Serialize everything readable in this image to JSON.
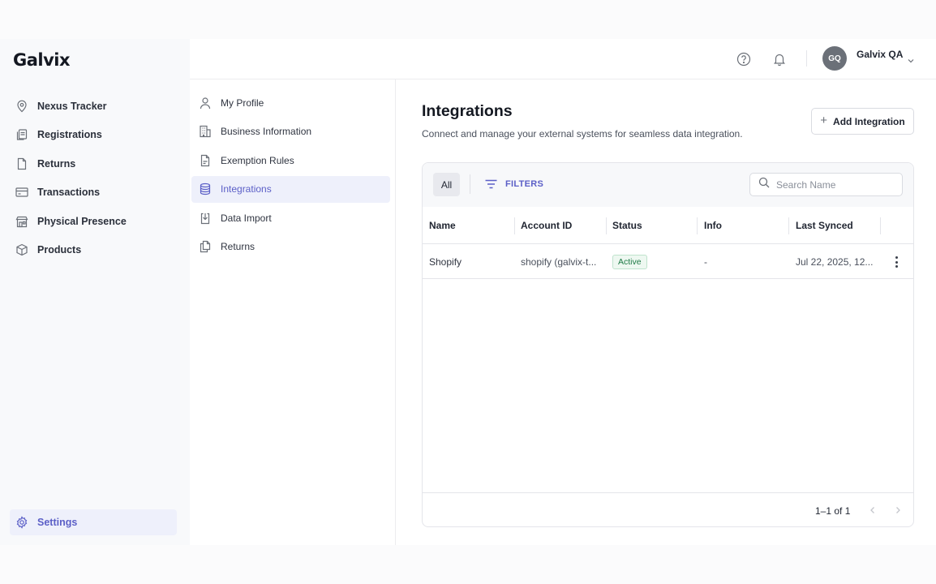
{
  "brand": {
    "logo_text": "Galvix"
  },
  "sidebar": {
    "items": [
      {
        "label": "Nexus Tracker",
        "icon": "map-pin-icon"
      },
      {
        "label": "Registrations",
        "icon": "documents-icon"
      },
      {
        "label": "Returns",
        "icon": "file-icon"
      },
      {
        "label": "Transactions",
        "icon": "card-icon"
      },
      {
        "label": "Physical Presence",
        "icon": "storefront-icon"
      },
      {
        "label": "Products",
        "icon": "box-icon"
      }
    ],
    "settings_label": "Settings"
  },
  "header": {
    "user_initials": "GQ",
    "user_name": "Galvix QA",
    "icons": [
      "help-icon",
      "bell-icon",
      "chevron-down-icon"
    ]
  },
  "settings_nav": {
    "items": [
      {
        "label": "My Profile",
        "icon": "user-icon",
        "active": false
      },
      {
        "label": "Business Information",
        "icon": "building-icon",
        "active": false
      },
      {
        "label": "Exemption Rules",
        "icon": "document-icon",
        "active": false
      },
      {
        "label": "Integrations",
        "icon": "database-icon",
        "active": true
      },
      {
        "label": "Data Import",
        "icon": "download-icon",
        "active": false
      },
      {
        "label": "Returns",
        "icon": "copy-icon",
        "active": false
      }
    ]
  },
  "page": {
    "title": "Integrations",
    "subtitle": "Connect and manage your external systems for seamless data integration.",
    "add_button": "Add Integration"
  },
  "toolbar": {
    "all_label": "All",
    "filters_label": "FILTERS",
    "search_placeholder": "Search Name",
    "search_value": ""
  },
  "table": {
    "columns": [
      "Name",
      "Account ID",
      "Status",
      "Info",
      "Last Synced"
    ],
    "rows": [
      {
        "name": "Shopify",
        "account_id": "shopify (galvix-t...",
        "status": "Active",
        "info": "-",
        "last_synced": "Jul 22, 2025, 12..."
      }
    ]
  },
  "pagination": {
    "range": "1–1 of 1"
  },
  "colors": {
    "accent": "#5b5fc7",
    "active_bg": "#eef0fb",
    "status_active": "#1e7a46"
  }
}
